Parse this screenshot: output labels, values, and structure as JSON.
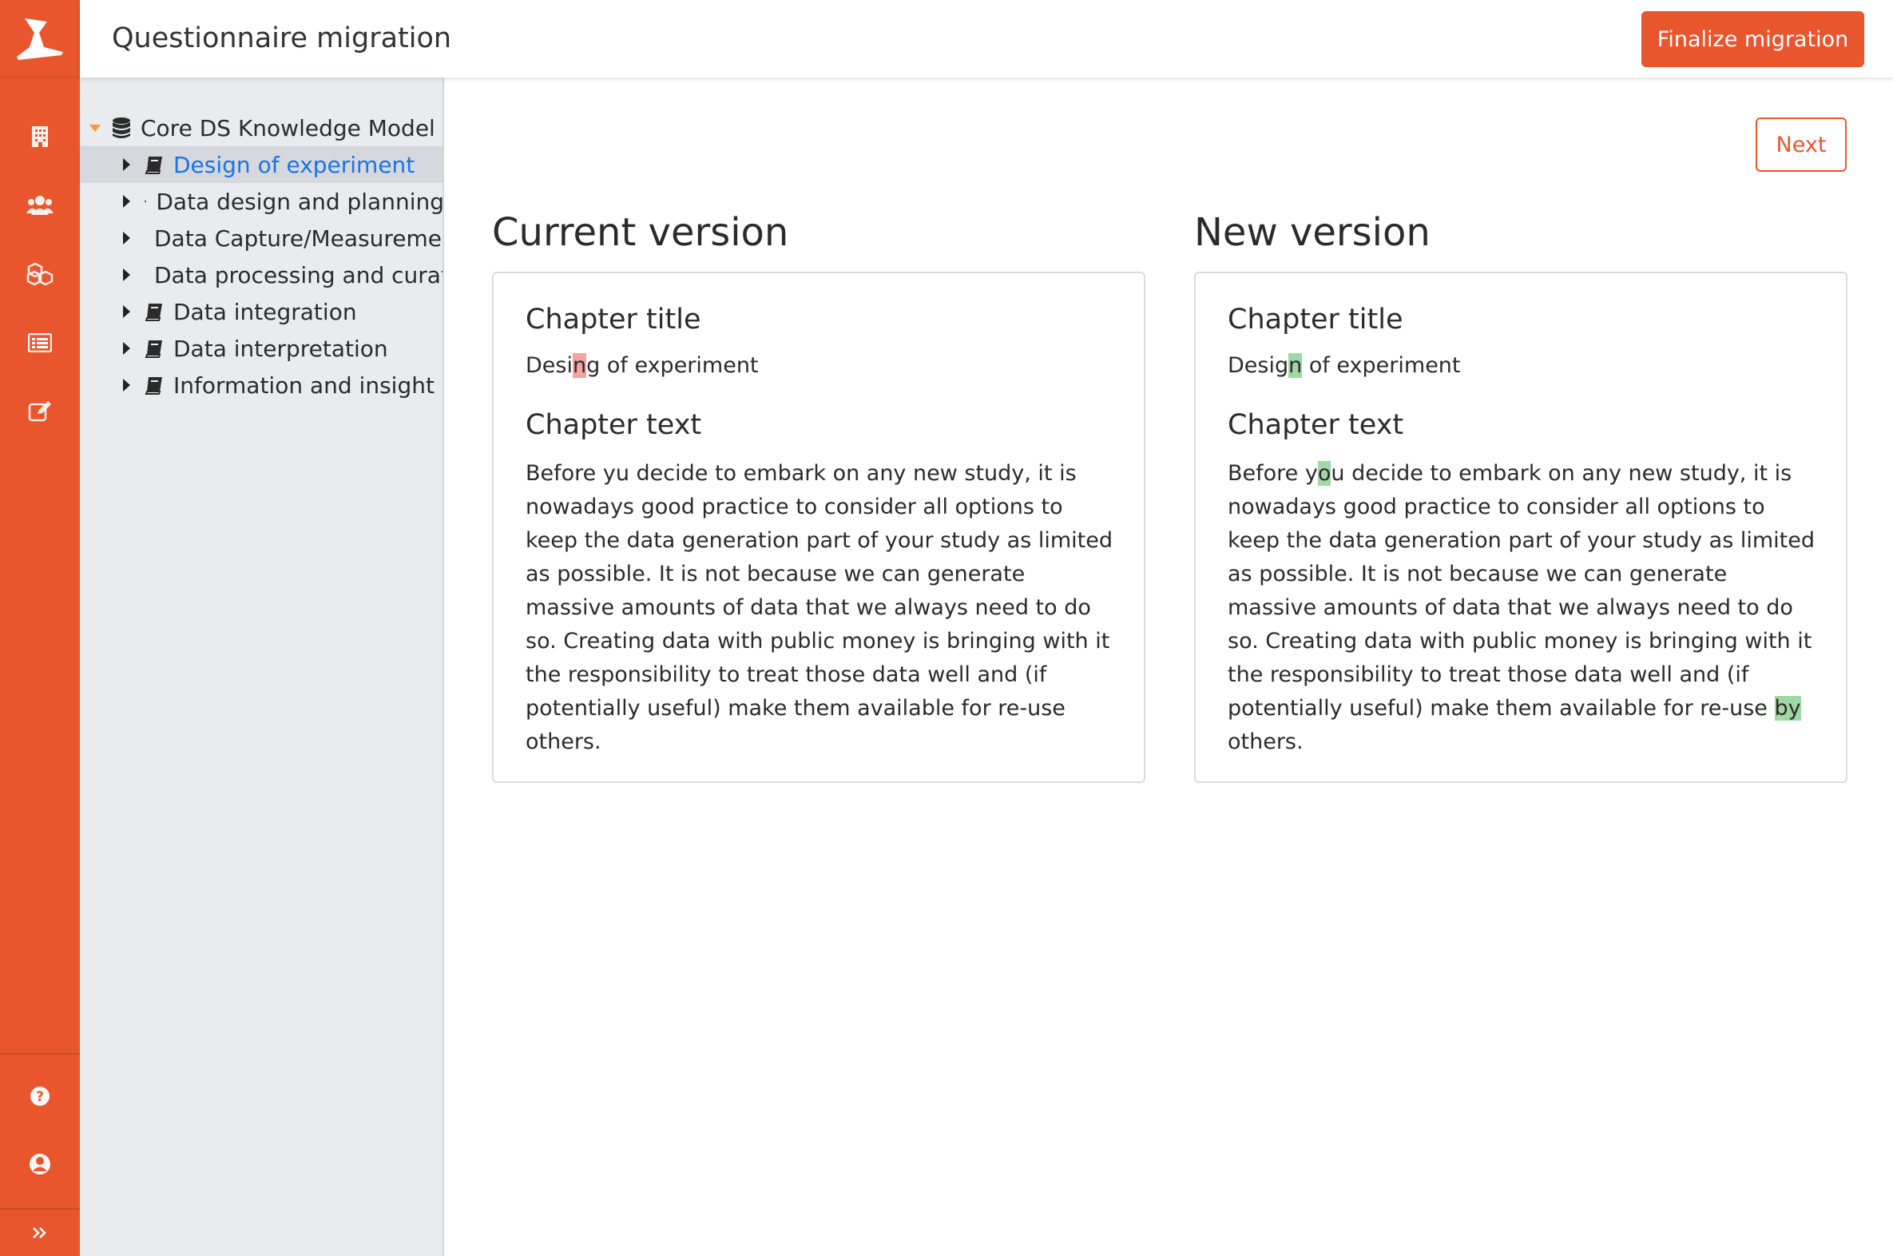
{
  "header": {
    "title": "Questionnaire migration",
    "finalize_label": "Finalize migration"
  },
  "colors": {
    "brand": "#e9562e",
    "deleted_highlight": "#f4a3a3",
    "inserted_highlight": "#9fd8a4",
    "selected_link": "#1a73e8"
  },
  "rail": {
    "icons": [
      "building-icon",
      "users-icon",
      "cubes-icon",
      "list-icon",
      "edit-icon",
      "question-circle-icon",
      "user-circle-icon",
      "double-chevron-right-icon"
    ]
  },
  "tree": {
    "root_label": "Core DS Knowledge Model",
    "items": [
      {
        "label": "Design of experiment"
      },
      {
        "label": "Data design and planning"
      },
      {
        "label": "Data Capture/Measurement"
      },
      {
        "label": "Data processing and curation"
      },
      {
        "label": "Data integration"
      },
      {
        "label": "Data interpretation"
      },
      {
        "label": "Information and insight"
      }
    ]
  },
  "next_label": "Next",
  "current": {
    "heading": "Current version",
    "title_heading": "Chapter title",
    "title_pre": "Desi",
    "title_del": "n",
    "title_post": "g of experiment",
    "text_heading": "Chapter text",
    "text": "Before yu decide to embark on any new study, it is nowadays good practice to consider all options to keep the data generation part of your study as limited as possible. It is not because we can generate massive amounts of data that we always need to do so. Creating data with public money is bringing with it the responsibility to treat those data well and (if potentially useful) make them available for re-use others."
  },
  "new": {
    "heading": "New version",
    "title_heading": "Chapter title",
    "title_pre": "Desig",
    "title_ins": "n",
    "title_post": " of experiment",
    "text_heading": "Chapter text",
    "text_pre": "Before y",
    "text_ins1": "o",
    "text_mid": "u decide to embark on any new study, it is nowadays good practice to consider all options to keep the data generation part of your study as limited as possible. It is not because we can generate massive amounts of data that we always need to do so. Creating data with public money is bringing with it the responsibility to treat those data well and (if potentially useful) make them available for re-use ",
    "text_ins2": "by",
    "text_post": " others."
  }
}
